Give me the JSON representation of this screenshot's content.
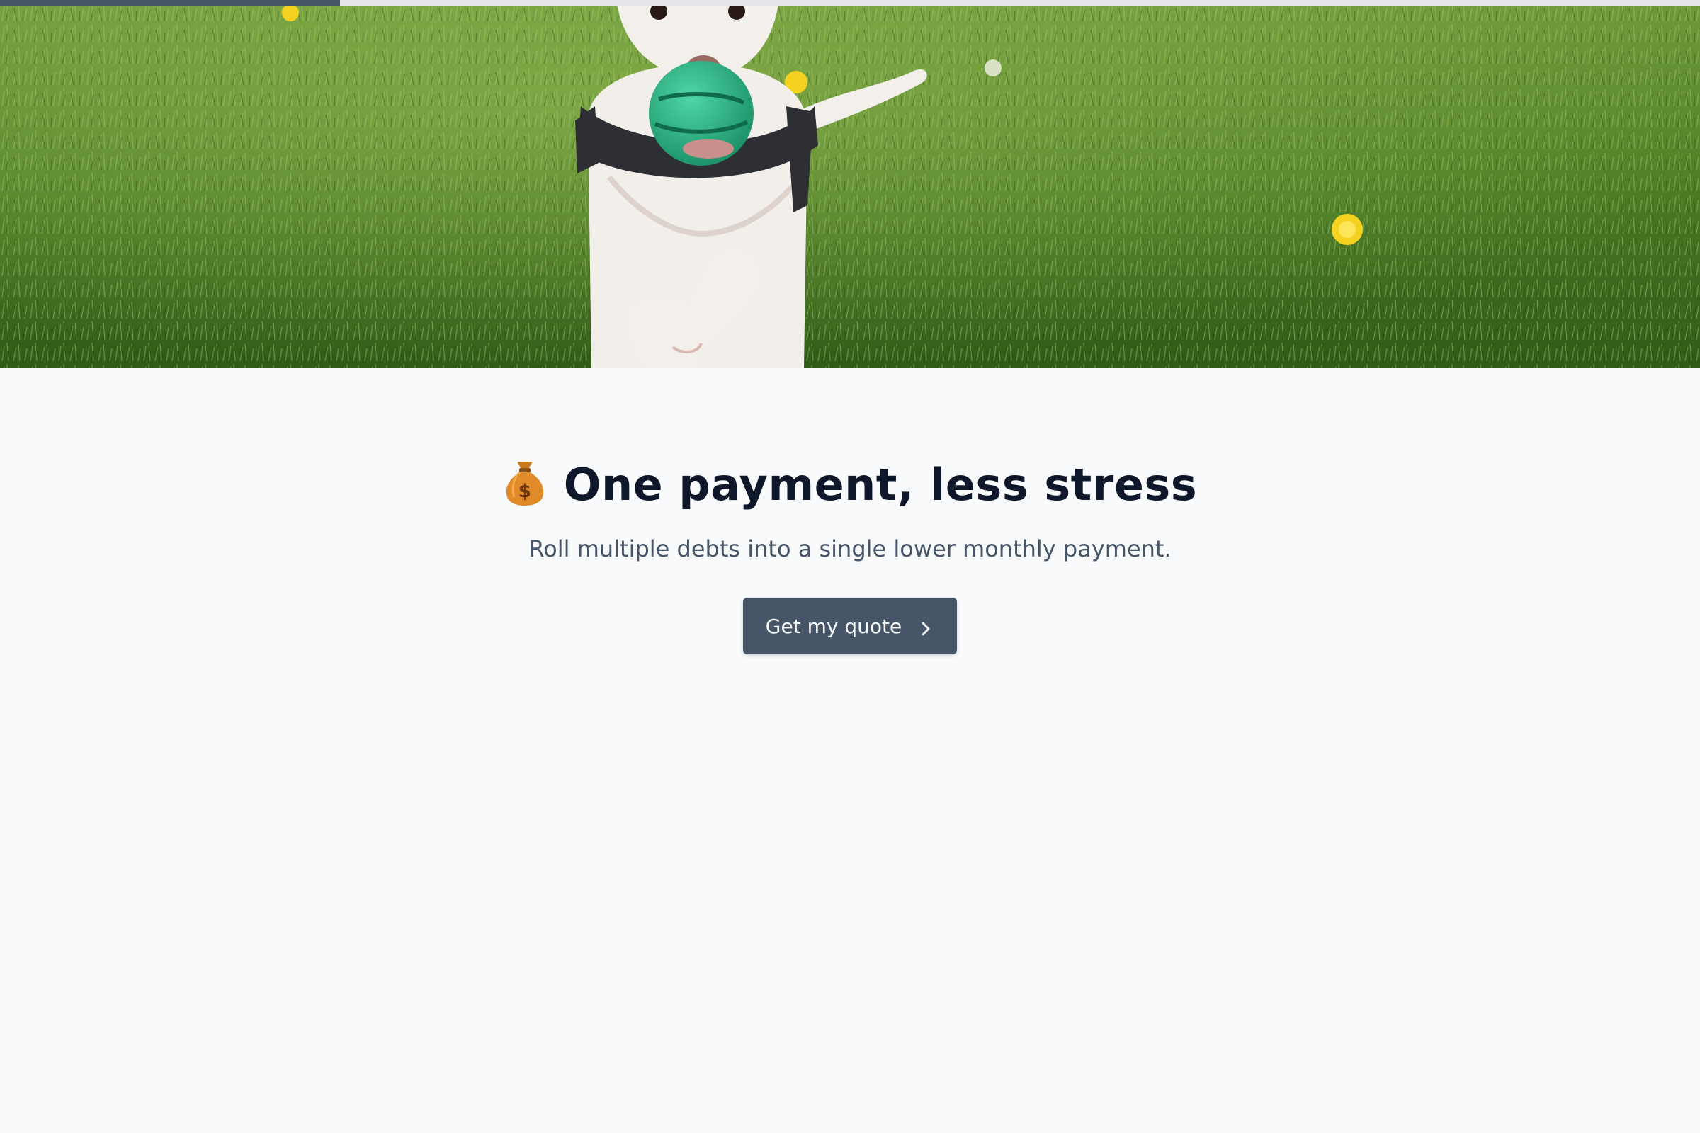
{
  "progress": {
    "fraction": 0.2,
    "fill_color": "#475569",
    "track_color": "#e5e7eb"
  },
  "hero": {
    "image_subject": "white dog running on grass with green ball in mouth"
  },
  "main": {
    "emoji_icon": "money-bag-icon",
    "headline": "One payment, less stress",
    "subtitle": "Roll multiple debts into a single lower monthly payment.",
    "cta_label": "Get my quote",
    "cta_icon": "chevron-right-icon"
  },
  "colors": {
    "page_bg": "#f8fafc",
    "headline": "#0f172a",
    "subtitle": "#475569",
    "button_bg": "#475569",
    "button_text": "#f8fafc"
  }
}
